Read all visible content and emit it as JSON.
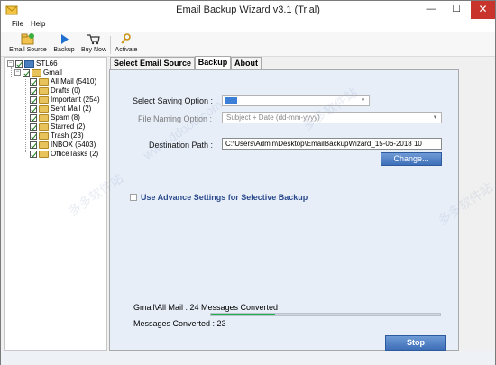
{
  "window": {
    "title": "Email Backup Wizard v3.1 (Trial)",
    "minimize": "—",
    "maximize": "☐",
    "close": "✕"
  },
  "menu": [
    "File",
    "Help"
  ],
  "toolbar": [
    {
      "label": "Email Source",
      "icon": "email-source-icon"
    },
    {
      "label": "Backup",
      "icon": "backup-play-icon"
    },
    {
      "label": "Buy Now",
      "icon": "cart-icon"
    },
    {
      "label": "Activate",
      "icon": "key-icon"
    }
  ],
  "tree": {
    "root": "STL66",
    "account": "Gmail",
    "folders": [
      "All Mail (5410)",
      "Drafts (0)",
      "Important (254)",
      "Sent Mail (2)",
      "Spam (8)",
      "Starred (2)",
      "Trash (23)",
      "INBOX (5403)",
      "OfficeTasks (2)"
    ]
  },
  "tabs": [
    "Select Email Source",
    "Backup",
    "About"
  ],
  "backup": {
    "saving_label": "Select Saving Option :",
    "naming_label": "File Naming Option :",
    "naming_value": "Subject + Date (dd-mm-yyyy)",
    "destination_label": "Destination Path :",
    "destination_value": "C:\\Users\\Admin\\Desktop\\EmailBackupWizard_15-06-2018 10",
    "change_button": "Change...",
    "advance_label": "Use Advance Settings for Selective Backup",
    "status_line": "Gmail\\All Mail : 24 Messages Converted",
    "converted_line": "Messages Converted : 23",
    "progress": 0.28,
    "stop_button": "Stop"
  },
  "colors": {
    "accent": "#3e6fb8",
    "progress": "#22b14c",
    "close": "#c8342b"
  }
}
